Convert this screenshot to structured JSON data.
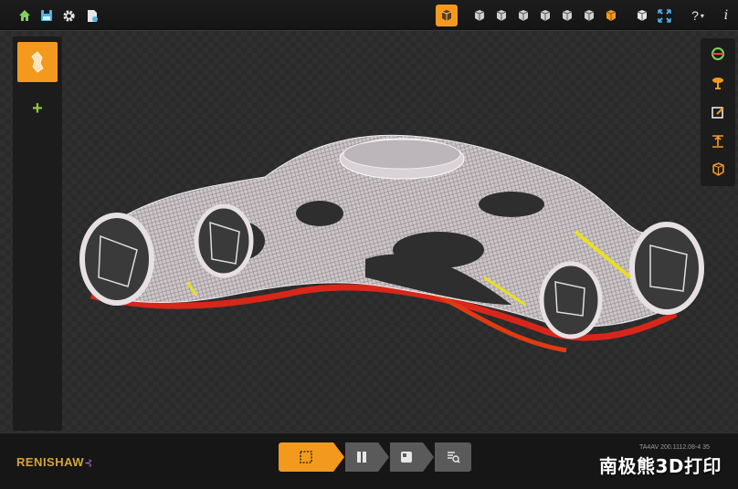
{
  "toolbar": {
    "left_icons": [
      "home-icon",
      "save-icon",
      "gear-icon",
      "document-settings-icon"
    ],
    "active_color": "#f39a1e",
    "view_icons": [
      "view-icon",
      "view-icon",
      "view-icon",
      "view-icon",
      "view-icon",
      "view-icon",
      "view-icon"
    ],
    "help_label": "?",
    "info_label": "i"
  },
  "left_panel": {
    "add_label": "+"
  },
  "right_panel": {
    "icons": [
      "orbit-icon",
      "support-icon",
      "edit-icon",
      "height-icon",
      "part-icon"
    ]
  },
  "bottom": {
    "logo_text": "RENISHAW",
    "logo_suffix": "⊰",
    "steps": [
      "select-step",
      "layout-step",
      "support-step",
      "preview-step"
    ],
    "version": "TA4AV 200.1112.08-4 35",
    "watermark": "南极熊3D打印"
  },
  "colors": {
    "accent": "#f39a1e",
    "add": "#8fc83a",
    "logo": "#d4a637"
  }
}
